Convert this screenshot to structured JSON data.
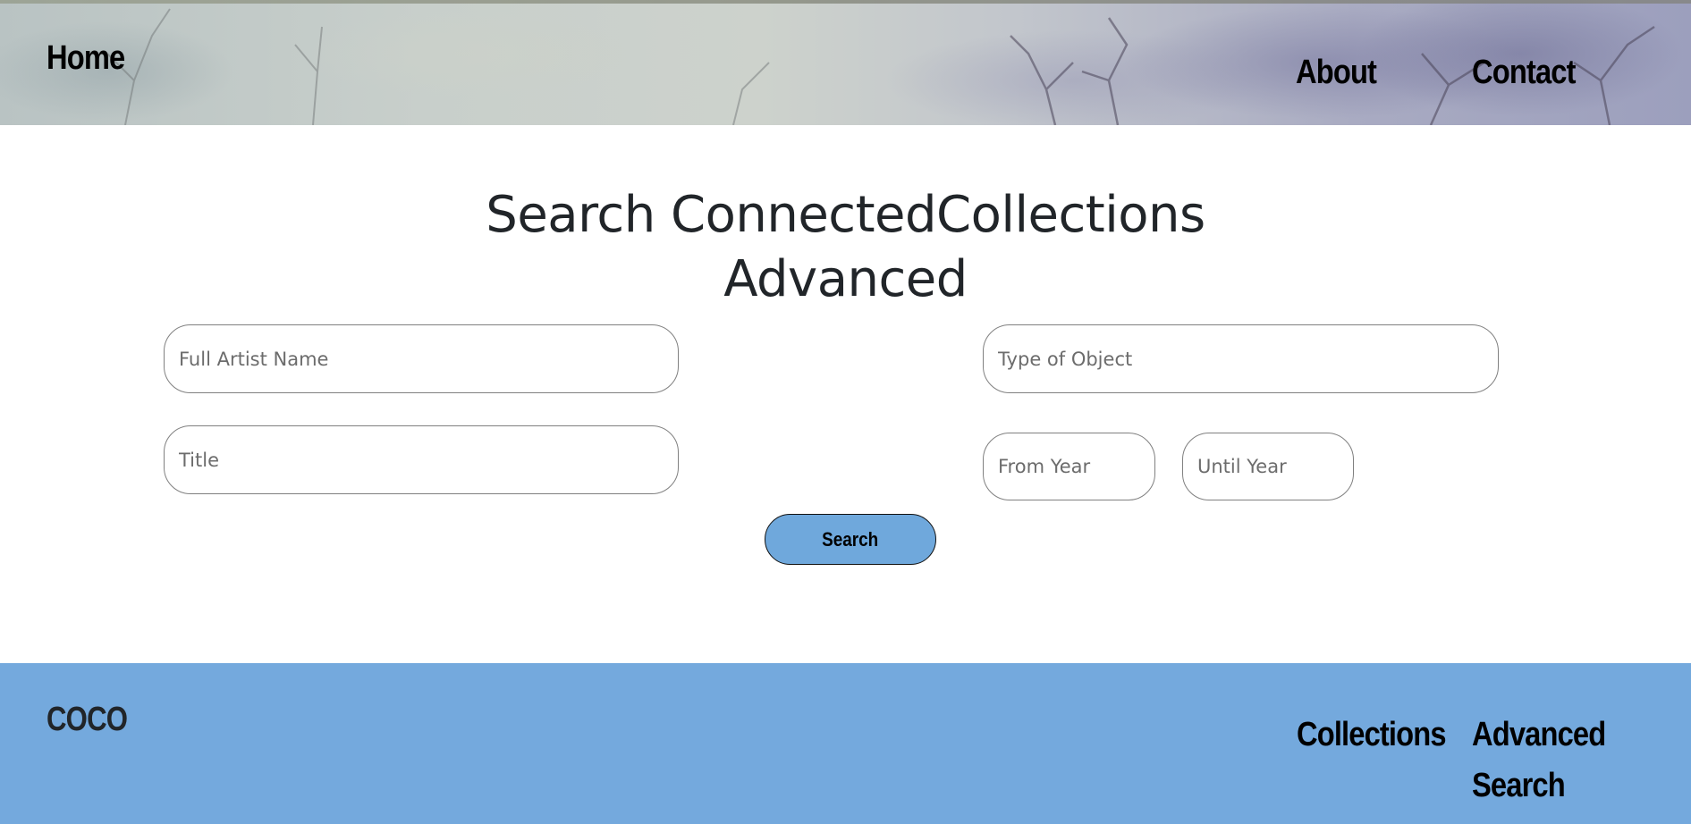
{
  "header": {
    "home_label": "Home",
    "about_label": "About",
    "contact_label": "Contact"
  },
  "main": {
    "title_line1": "Search ConnectedCollections",
    "title_line2": "Advanced",
    "fields": {
      "artist_placeholder": "Full Artist Name",
      "type_placeholder": "Type of Object",
      "title_placeholder": "Title",
      "from_year_placeholder": "From Year",
      "until_year_placeholder": "Until Year"
    },
    "search_label": "Search"
  },
  "footer": {
    "logo": "COCO",
    "collections_label": "Collections",
    "advanced_search_label": "Advanced Search"
  },
  "colors": {
    "accent": "#74a9dd",
    "button": "#6fa8dc",
    "text": "#212529"
  }
}
